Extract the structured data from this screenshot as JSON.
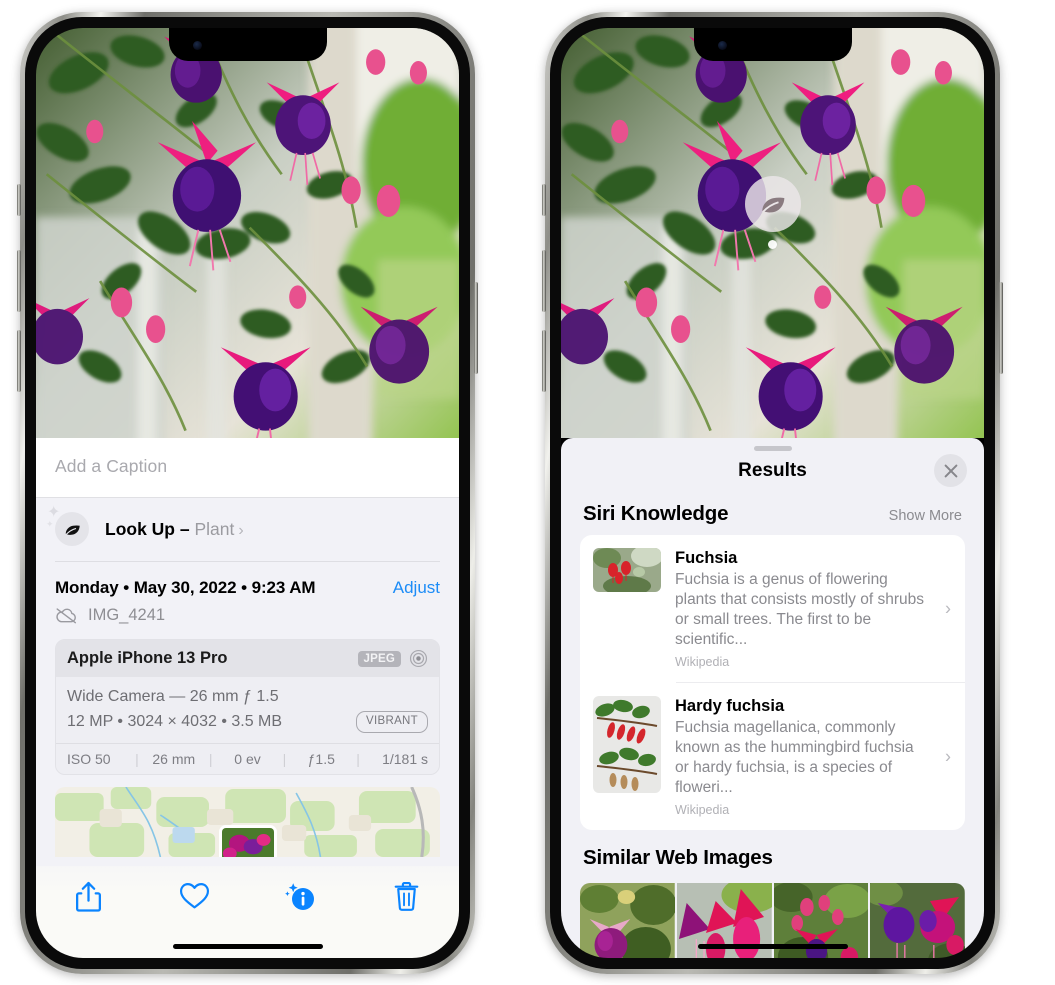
{
  "theme": {
    "accent_blue": "#1c8cf7",
    "sheet_bg": "#f2f2f7",
    "card_bg": "#ffffff",
    "muted_text": "#8e8e93"
  },
  "left_phone": {
    "caption": {
      "placeholder": "Add a Caption",
      "value": ""
    },
    "lookup": {
      "icon": "leaf-icon",
      "label": "Look Up –",
      "subject": "Plant",
      "chevron": "›"
    },
    "meta": {
      "date": "Monday • May 30, 2022 • 9:23 AM",
      "adjust_label": "Adjust",
      "cloud_icon": "cloud-slash-icon",
      "filename": "IMG_4241"
    },
    "camera_card": {
      "device": "Apple iPhone 13 Pro",
      "format_badge": "JPEG",
      "aperture_icon": "raw-target-icon",
      "lens_line": "Wide Camera — 26 mm ƒ 1.5",
      "spec_line": "12 MP • 3024 × 4032 • 3.5 MB",
      "style_badge": "VIBRANT",
      "exif": [
        "ISO 50",
        "26 mm",
        "0 ev",
        "ƒ1.5",
        "1/181 s"
      ]
    },
    "toolbar": [
      {
        "name": "share-button",
        "icon": "share-icon"
      },
      {
        "name": "favorite-button",
        "icon": "heart-icon"
      },
      {
        "name": "info-button",
        "icon": "info-sparkle-icon"
      },
      {
        "name": "delete-button",
        "icon": "trash-icon"
      }
    ]
  },
  "right_phone": {
    "marker": {
      "icon": "leaf-icon"
    },
    "sheet": {
      "title": "Results",
      "close_icon": "close-icon"
    },
    "siri_knowledge": {
      "heading": "Siri Knowledge",
      "action": "Show More",
      "items": [
        {
          "name": "Fuchsia",
          "description": "Fuchsia is a genus of flowering plants that consists mostly of shrubs or small trees. The first to be scientific...",
          "source": "Wikipedia",
          "chevron": "›"
        },
        {
          "name": "Hardy fuchsia",
          "description": "Fuchsia magellanica, commonly known as the hummingbird fuchsia or hardy fuchsia, is a species of floweri...",
          "source": "Wikipedia",
          "chevron": "›"
        }
      ]
    },
    "similar_web_images": {
      "heading": "Similar Web Images",
      "count": 4
    }
  }
}
